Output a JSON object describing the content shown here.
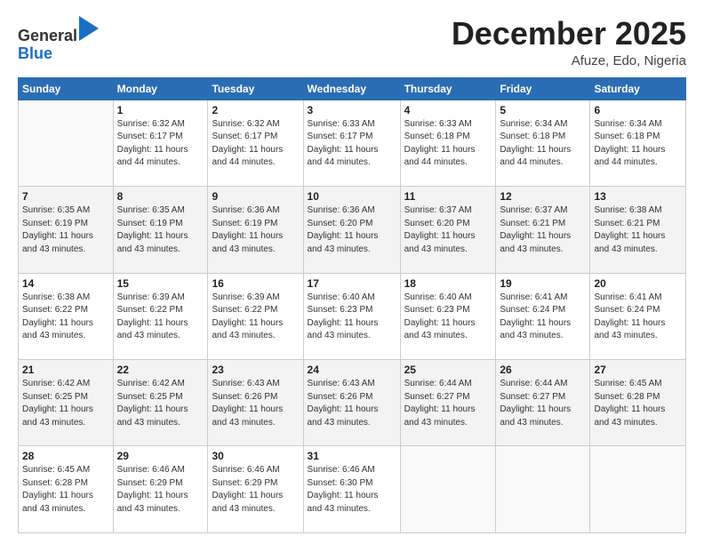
{
  "header": {
    "logo_line1": "General",
    "logo_line2": "Blue",
    "month": "December 2025",
    "location": "Afuze, Edo, Nigeria"
  },
  "days_of_week": [
    "Sunday",
    "Monday",
    "Tuesday",
    "Wednesday",
    "Thursday",
    "Friday",
    "Saturday"
  ],
  "weeks": [
    [
      {
        "num": "",
        "info": ""
      },
      {
        "num": "1",
        "info": "Sunrise: 6:32 AM\nSunset: 6:17 PM\nDaylight: 11 hours\nand 44 minutes."
      },
      {
        "num": "2",
        "info": "Sunrise: 6:32 AM\nSunset: 6:17 PM\nDaylight: 11 hours\nand 44 minutes."
      },
      {
        "num": "3",
        "info": "Sunrise: 6:33 AM\nSunset: 6:17 PM\nDaylight: 11 hours\nand 44 minutes."
      },
      {
        "num": "4",
        "info": "Sunrise: 6:33 AM\nSunset: 6:18 PM\nDaylight: 11 hours\nand 44 minutes."
      },
      {
        "num": "5",
        "info": "Sunrise: 6:34 AM\nSunset: 6:18 PM\nDaylight: 11 hours\nand 44 minutes."
      },
      {
        "num": "6",
        "info": "Sunrise: 6:34 AM\nSunset: 6:18 PM\nDaylight: 11 hours\nand 44 minutes."
      }
    ],
    [
      {
        "num": "7",
        "info": "Sunrise: 6:35 AM\nSunset: 6:19 PM\nDaylight: 11 hours\nand 43 minutes."
      },
      {
        "num": "8",
        "info": "Sunrise: 6:35 AM\nSunset: 6:19 PM\nDaylight: 11 hours\nand 43 minutes."
      },
      {
        "num": "9",
        "info": "Sunrise: 6:36 AM\nSunset: 6:19 PM\nDaylight: 11 hours\nand 43 minutes."
      },
      {
        "num": "10",
        "info": "Sunrise: 6:36 AM\nSunset: 6:20 PM\nDaylight: 11 hours\nand 43 minutes."
      },
      {
        "num": "11",
        "info": "Sunrise: 6:37 AM\nSunset: 6:20 PM\nDaylight: 11 hours\nand 43 minutes."
      },
      {
        "num": "12",
        "info": "Sunrise: 6:37 AM\nSunset: 6:21 PM\nDaylight: 11 hours\nand 43 minutes."
      },
      {
        "num": "13",
        "info": "Sunrise: 6:38 AM\nSunset: 6:21 PM\nDaylight: 11 hours\nand 43 minutes."
      }
    ],
    [
      {
        "num": "14",
        "info": "Sunrise: 6:38 AM\nSunset: 6:22 PM\nDaylight: 11 hours\nand 43 minutes."
      },
      {
        "num": "15",
        "info": "Sunrise: 6:39 AM\nSunset: 6:22 PM\nDaylight: 11 hours\nand 43 minutes."
      },
      {
        "num": "16",
        "info": "Sunrise: 6:39 AM\nSunset: 6:22 PM\nDaylight: 11 hours\nand 43 minutes."
      },
      {
        "num": "17",
        "info": "Sunrise: 6:40 AM\nSunset: 6:23 PM\nDaylight: 11 hours\nand 43 minutes."
      },
      {
        "num": "18",
        "info": "Sunrise: 6:40 AM\nSunset: 6:23 PM\nDaylight: 11 hours\nand 43 minutes."
      },
      {
        "num": "19",
        "info": "Sunrise: 6:41 AM\nSunset: 6:24 PM\nDaylight: 11 hours\nand 43 minutes."
      },
      {
        "num": "20",
        "info": "Sunrise: 6:41 AM\nSunset: 6:24 PM\nDaylight: 11 hours\nand 43 minutes."
      }
    ],
    [
      {
        "num": "21",
        "info": "Sunrise: 6:42 AM\nSunset: 6:25 PM\nDaylight: 11 hours\nand 43 minutes."
      },
      {
        "num": "22",
        "info": "Sunrise: 6:42 AM\nSunset: 6:25 PM\nDaylight: 11 hours\nand 43 minutes."
      },
      {
        "num": "23",
        "info": "Sunrise: 6:43 AM\nSunset: 6:26 PM\nDaylight: 11 hours\nand 43 minutes."
      },
      {
        "num": "24",
        "info": "Sunrise: 6:43 AM\nSunset: 6:26 PM\nDaylight: 11 hours\nand 43 minutes."
      },
      {
        "num": "25",
        "info": "Sunrise: 6:44 AM\nSunset: 6:27 PM\nDaylight: 11 hours\nand 43 minutes."
      },
      {
        "num": "26",
        "info": "Sunrise: 6:44 AM\nSunset: 6:27 PM\nDaylight: 11 hours\nand 43 minutes."
      },
      {
        "num": "27",
        "info": "Sunrise: 6:45 AM\nSunset: 6:28 PM\nDaylight: 11 hours\nand 43 minutes."
      }
    ],
    [
      {
        "num": "28",
        "info": "Sunrise: 6:45 AM\nSunset: 6:28 PM\nDaylight: 11 hours\nand 43 minutes."
      },
      {
        "num": "29",
        "info": "Sunrise: 6:46 AM\nSunset: 6:29 PM\nDaylight: 11 hours\nand 43 minutes."
      },
      {
        "num": "30",
        "info": "Sunrise: 6:46 AM\nSunset: 6:29 PM\nDaylight: 11 hours\nand 43 minutes."
      },
      {
        "num": "31",
        "info": "Sunrise: 6:46 AM\nSunset: 6:30 PM\nDaylight: 11 hours\nand 43 minutes."
      },
      {
        "num": "",
        "info": ""
      },
      {
        "num": "",
        "info": ""
      },
      {
        "num": "",
        "info": ""
      }
    ]
  ]
}
